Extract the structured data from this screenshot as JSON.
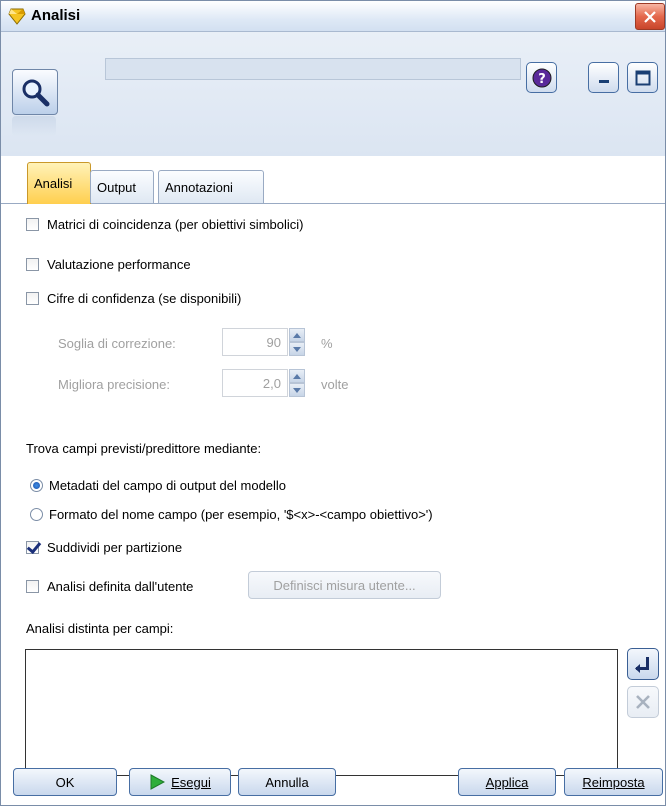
{
  "window": {
    "title": "Analisi"
  },
  "tabs": [
    {
      "label": "Analisi",
      "active": true
    },
    {
      "label": "Output",
      "active": false
    },
    {
      "label": "Annotazioni",
      "active": false
    }
  ],
  "options": {
    "coincidence": {
      "label": "Matrici di coincidenza (per obiettivi simbolici)",
      "checked": false
    },
    "performance": {
      "label": "Valutazione performance",
      "checked": false
    },
    "confidence": {
      "label": "Cifre di confidenza (se disponibili)",
      "checked": false
    },
    "threshold": {
      "label": "Soglia di correzione:",
      "value": "90",
      "unit": "%"
    },
    "improve": {
      "label": "Migliora precisione:",
      "value": "2,0",
      "unit": "volte"
    }
  },
  "find_fields": {
    "label": "Trova campi previsti/predittore mediante:",
    "options": [
      {
        "label": "Metadati del campo di output del modello",
        "selected": true
      },
      {
        "label": "Formato del nome campo (per esempio, '$<x>-<campo obiettivo>')",
        "selected": false
      }
    ]
  },
  "split_partition": {
    "label": "Suddividi per partizione",
    "checked": true
  },
  "user_analysis": {
    "label": "Analisi definita dall'utente",
    "checked": false,
    "button": "Definisci misura utente..."
  },
  "breakdown": {
    "label": "Analisi distinta per campi:"
  },
  "footer": {
    "ok": "OK",
    "run": "Esegui",
    "cancel": "Annulla",
    "apply": "Applica",
    "reset": "Reimposta"
  },
  "colors": {
    "accent": "#ffcf4e",
    "frame": "#476ea3",
    "run_arrow": "#2fae3a"
  }
}
